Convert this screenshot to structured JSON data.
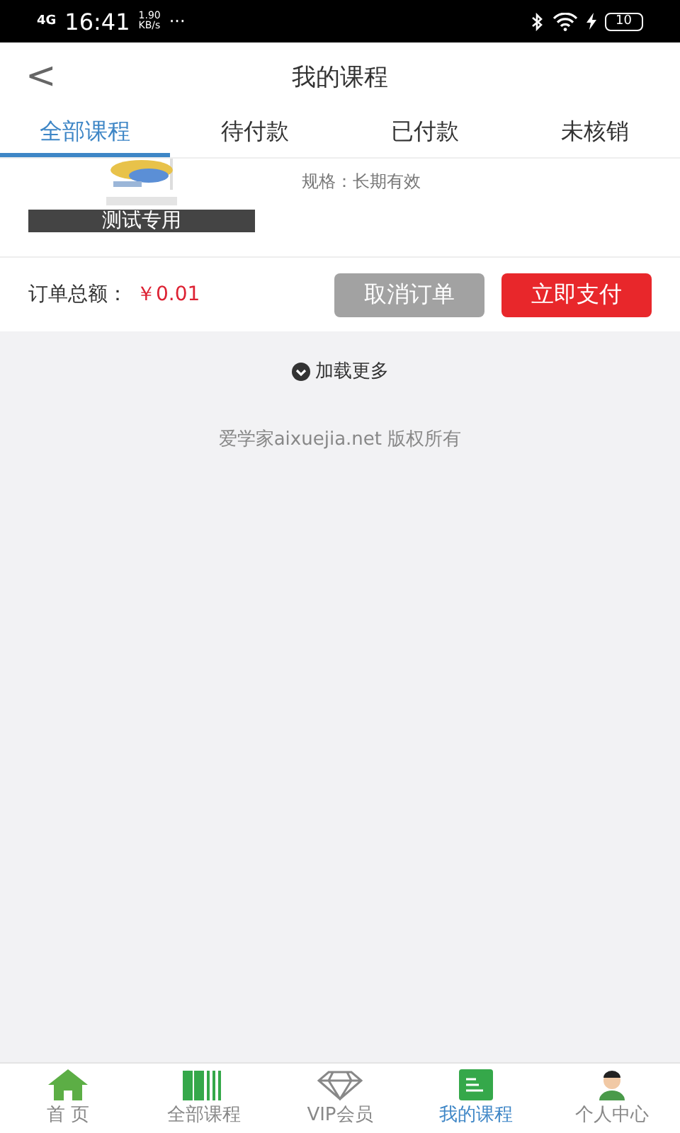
{
  "status_bar": {
    "network": "4G",
    "time": "16:41",
    "speed": "1.90\nKB/s",
    "more": "···",
    "battery": "10"
  },
  "header": {
    "back": "<",
    "title": "我的课程"
  },
  "tabs": [
    {
      "label": "全部课程",
      "selected": true
    },
    {
      "label": "待付款",
      "selected": false
    },
    {
      "label": "已付款",
      "selected": false
    },
    {
      "label": "未核销",
      "selected": false
    }
  ],
  "order": {
    "image_caption": "测试专用",
    "spec": "规格：长期有效",
    "total_label": "订单总额：",
    "total": "￥0.01",
    "buttons": [
      {
        "label": "取消订单",
        "kind": "secondary"
      },
      {
        "label": "立即支付",
        "kind": "primary"
      }
    ]
  },
  "load_more": "加载更多",
  "copyright": "爱学家aixuejia.net 版权所有",
  "bottom_nav": [
    {
      "label": "首 页",
      "kind": "home",
      "selected": false
    },
    {
      "label": "全部课程",
      "kind": "books",
      "selected": false
    },
    {
      "label": "VIP会员",
      "kind": "diamond",
      "selected": false
    },
    {
      "label": "我的课程",
      "kind": "book",
      "selected": true
    },
    {
      "label": "个人中心",
      "kind": "person",
      "selected": false
    }
  ]
}
